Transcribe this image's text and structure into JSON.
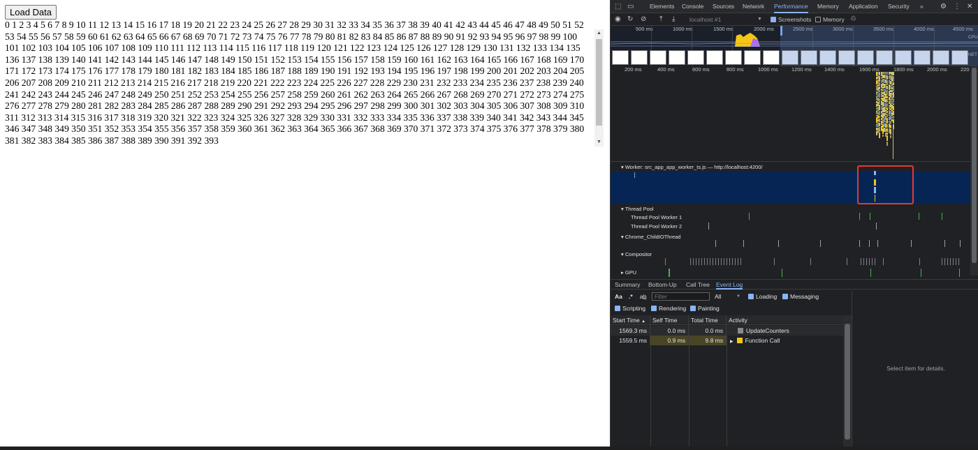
{
  "page": {
    "load_button": "Load Data",
    "numbers_count": 394
  },
  "devtools": {
    "tabs": [
      "Elements",
      "Console",
      "Sources",
      "Network",
      "Performance",
      "Memory",
      "Application",
      "Security"
    ],
    "more_tabs": "»",
    "active_tab": "Performance",
    "perf_toolbar": {
      "recording_select": "localhost #1",
      "screenshots_label": "Screenshots",
      "screenshots_checked": true,
      "memory_label": "Memory",
      "memory_checked": false
    },
    "overview": {
      "ticks": [
        "500 ms",
        "1000 ms",
        "1500 ms",
        "2000 ms",
        "2500 ms",
        "3000 ms",
        "3500 ms",
        "4000 ms",
        "4500 ms"
      ],
      "cpu_label": "CPU",
      "net_label": "NET"
    },
    "ruler": [
      "200 ms",
      "400 ms",
      "600 ms",
      "800 ms",
      "1000 ms",
      "1200 ms",
      "1400 ms",
      "1600 ms",
      "1800 ms",
      "2000 ms",
      "220"
    ],
    "tracks": {
      "worker": "Worker: src_app_app_worker_ts.js — http://localhost:4200/",
      "thread_pool": "Thread Pool",
      "thread_pool_worker_1": "Thread Pool Worker 1",
      "thread_pool_worker_2": "Thread Pool Worker 2",
      "child_io": "Chrome_ChildIOThread",
      "compositor": "Compositor",
      "gpu": "GPU"
    },
    "bottom_tabs": [
      "Summary",
      "Bottom-Up",
      "Call Tree",
      "Event Log"
    ],
    "active_bottom_tab": "Event Log",
    "filter": {
      "case_label": "Aa",
      "regex_label": ".*",
      "placeholder": "Filter",
      "duration": "All",
      "categories": [
        {
          "label": "Loading",
          "checked": true
        },
        {
          "label": "Messaging",
          "checked": true
        },
        {
          "label": "Scripting",
          "checked": true
        },
        {
          "label": "Rendering",
          "checked": true
        },
        {
          "label": "Painting",
          "checked": true
        }
      ]
    },
    "table": {
      "headers": [
        "Start Time",
        "Self Time",
        "Total Time",
        "Activity"
      ],
      "rows": [
        {
          "start": "1569.3 ms",
          "self": "0.0 ms",
          "total": "0.0 ms",
          "activity": "UpdateCounters",
          "color": "#8a8a8a",
          "expandable": false
        },
        {
          "start": "1559.5 ms",
          "self": "0.9 ms",
          "total": "9.8 ms",
          "activity": "Function Call",
          "color": "#f5c518",
          "expandable": true
        }
      ]
    },
    "details_empty": "Select item for details."
  },
  "colors": {
    "accent": "#8ab4f8",
    "selection": "#062555",
    "highlight_box": "#e53935",
    "scripting": "#f5c518"
  }
}
